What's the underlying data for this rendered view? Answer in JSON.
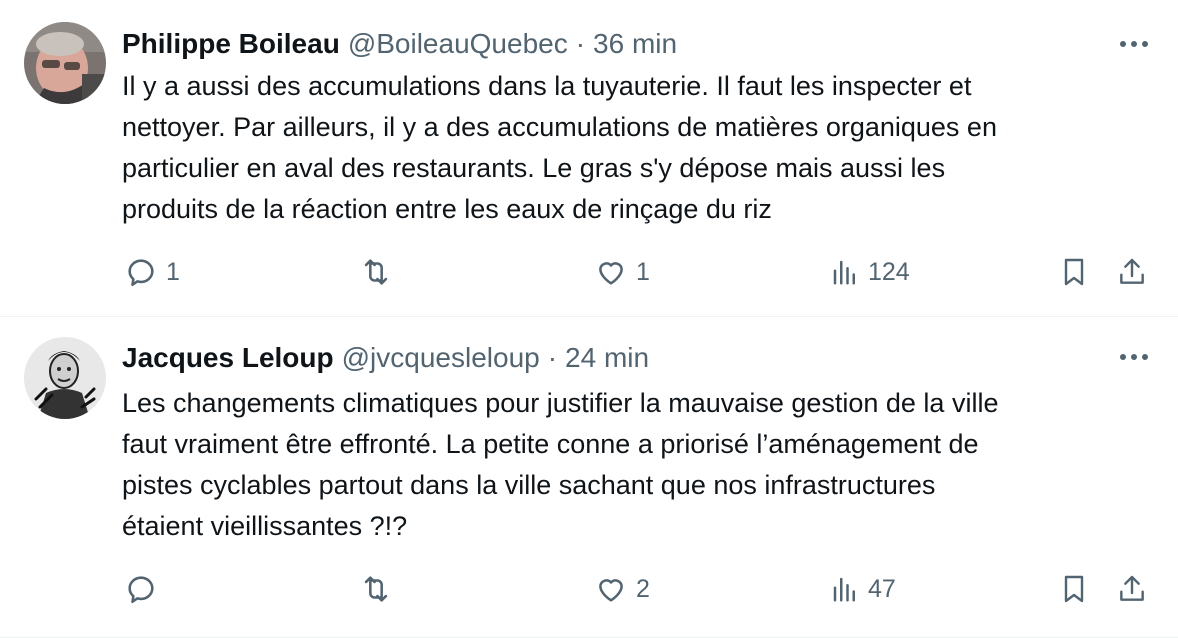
{
  "tweets": [
    {
      "name": "Philippe Boileau",
      "handle": "@BoileauQuebec",
      "separator": "·",
      "time": "36 min",
      "text": "Il y a aussi des accumulations dans la tuyauterie. Il faut les inspecter et\nnettoyer. Par ailleurs, il y a des accumulations de matières organiques en\nparticulier en aval des restaurants. Le gras s'y dépose mais aussi les\nproduits de la réaction entre les eaux de rinçage du riz",
      "replies": "1",
      "retweets": "",
      "likes": "1",
      "views": "124"
    },
    {
      "name": "Jacques Leloup",
      "handle": "@jvcquesleloup",
      "separator": "·",
      "time": "24 min",
      "text": "Les changements climatiques pour justifier la mauvaise gestion de la ville\nfaut vraiment être effronté. La petite conne a priorisé l’aménagement de\npistes cyclables partout dans la ville sachant que nos infrastructures\nétaient vieillissantes ?!?",
      "replies": "",
      "retweets": "",
      "likes": "2",
      "views": "47"
    }
  ],
  "icons": {
    "more": "more-horizontal-icon",
    "reply": "reply-bubble-icon",
    "retweet": "retweet-icon",
    "like": "heart-icon",
    "views": "views-bar-chart-icon",
    "bookmark": "bookmark-icon",
    "share": "share-upload-icon"
  },
  "colors": {
    "text": "#0f1419",
    "secondary": "#536471",
    "divider": "#eff3f4"
  }
}
